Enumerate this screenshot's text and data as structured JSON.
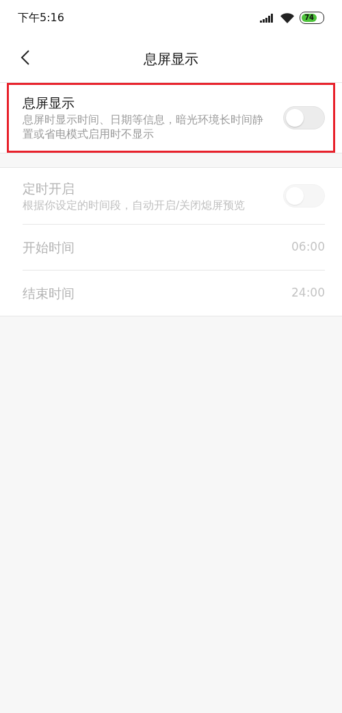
{
  "status_bar": {
    "time": "下午5:16",
    "battery": "74"
  },
  "header": {
    "title": "息屏显示"
  },
  "sections": [
    {
      "rows": [
        {
          "kind": "toggle",
          "title": "息屏显示",
          "description": "息屏时显示时间、日期等信息，暗光环境长时间静置或省电模式启用时不显示",
          "on": false,
          "disabled": false,
          "highlighted": true
        }
      ]
    },
    {
      "rows": [
        {
          "kind": "toggle",
          "title": "定时开启",
          "description": "根据你设定的时间段，自动开启/关闭熄屏预览",
          "on": false,
          "disabled": true,
          "highlighted": false
        },
        {
          "kind": "value",
          "title": "开始时间",
          "value": "06:00",
          "disabled": true,
          "highlighted": false
        },
        {
          "kind": "value",
          "title": "结束时间",
          "value": "24:00",
          "disabled": true,
          "highlighted": false
        }
      ]
    }
  ]
}
